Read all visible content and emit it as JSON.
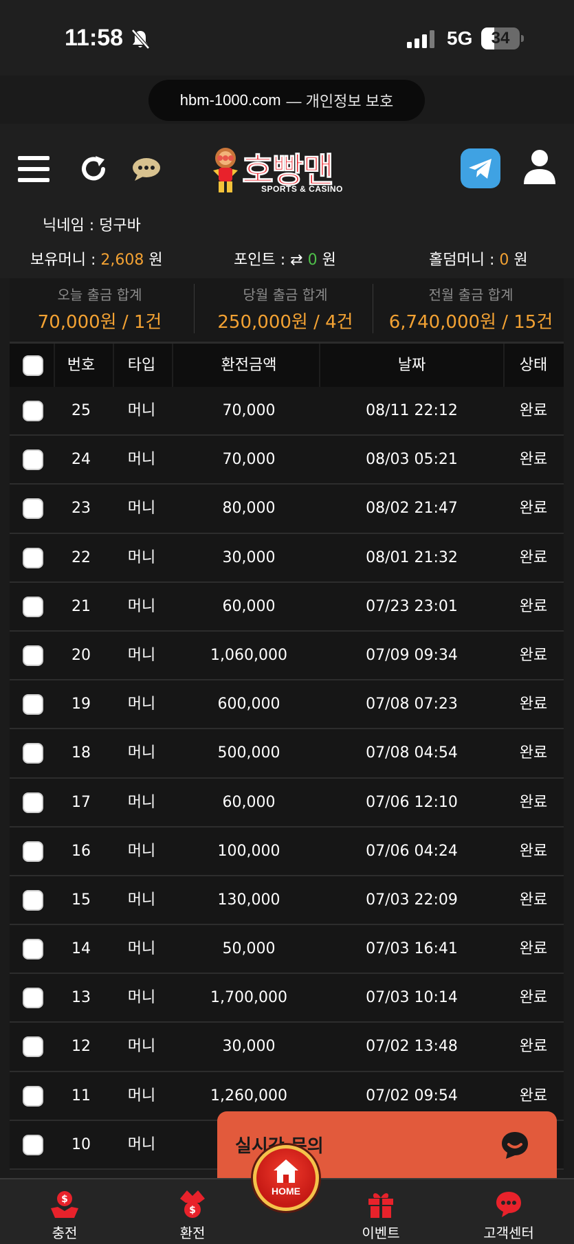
{
  "status_bar": {
    "time": "11:58",
    "network": "5G",
    "battery": "34",
    "battery_level": 0.34
  },
  "browser": {
    "url": "hbm-1000.com",
    "url_suffix": "— 개인정보 보호"
  },
  "header": {
    "logo_text": "호빵맨",
    "logo_subtitle": "SPORTS & CASINO"
  },
  "user": {
    "nickname_label": "닉네임 :",
    "nickname": "덩구바",
    "money_label": "보유머니 :",
    "money_value": "2,608",
    "money_unit": "원",
    "point_label": "포인트 :",
    "point_icon": "⇄",
    "point_value": "0",
    "point_unit": "원",
    "holdem_label": "홀덤머니 :",
    "holdem_value": "0",
    "holdem_unit": "원"
  },
  "summary": [
    {
      "label": "오늘 출금 합계",
      "value": "70,000원 / 1건"
    },
    {
      "label": "당월 출금 합계",
      "value": "250,000원 / 4건"
    },
    {
      "label": "전월 출금 합계",
      "value": "6,740,000원 / 15건"
    }
  ],
  "table": {
    "headers": {
      "number": "번호",
      "type": "타입",
      "amount": "환전금액",
      "date": "날짜",
      "status": "상태"
    },
    "rows": [
      {
        "number": "25",
        "type": "머니",
        "amount": "70,000",
        "date": "08/11 22:12",
        "status": "완료"
      },
      {
        "number": "24",
        "type": "머니",
        "amount": "70,000",
        "date": "08/03 05:21",
        "status": "완료"
      },
      {
        "number": "23",
        "type": "머니",
        "amount": "80,000",
        "date": "08/02 21:47",
        "status": "완료"
      },
      {
        "number": "22",
        "type": "머니",
        "amount": "30,000",
        "date": "08/01 21:32",
        "status": "완료"
      },
      {
        "number": "21",
        "type": "머니",
        "amount": "60,000",
        "date": "07/23 23:01",
        "status": "완료"
      },
      {
        "number": "20",
        "type": "머니",
        "amount": "1,060,000",
        "date": "07/09 09:34",
        "status": "완료"
      },
      {
        "number": "19",
        "type": "머니",
        "amount": "600,000",
        "date": "07/08 07:23",
        "status": "완료"
      },
      {
        "number": "18",
        "type": "머니",
        "amount": "500,000",
        "date": "07/08 04:54",
        "status": "완료"
      },
      {
        "number": "17",
        "type": "머니",
        "amount": "60,000",
        "date": "07/06 12:10",
        "status": "완료"
      },
      {
        "number": "16",
        "type": "머니",
        "amount": "100,000",
        "date": "07/06 04:24",
        "status": "완료"
      },
      {
        "number": "15",
        "type": "머니",
        "amount": "130,000",
        "date": "07/03 22:09",
        "status": "완료"
      },
      {
        "number": "14",
        "type": "머니",
        "amount": "50,000",
        "date": "07/03 16:41",
        "status": "완료"
      },
      {
        "number": "13",
        "type": "머니",
        "amount": "1,700,000",
        "date": "07/03 10:14",
        "status": "완료"
      },
      {
        "number": "12",
        "type": "머니",
        "amount": "30,000",
        "date": "07/02 13:48",
        "status": "완료"
      },
      {
        "number": "11",
        "type": "머니",
        "amount": "1,260,000",
        "date": "07/02 09:54",
        "status": "완료"
      },
      {
        "number": "10",
        "type": "머니",
        "amount": "",
        "date": "",
        "status": ""
      }
    ]
  },
  "live_chat": {
    "label": "실시간 문의"
  },
  "bottom_nav": {
    "deposit": "충전",
    "withdraw": "환전",
    "home": "HOME",
    "event": "이벤트",
    "support": "고객센터"
  },
  "colors": {
    "accent_orange": "#f3a233",
    "point_green": "#4fc04a",
    "brand_red": "#e8222b",
    "chat_orange": "#e25a3c"
  }
}
